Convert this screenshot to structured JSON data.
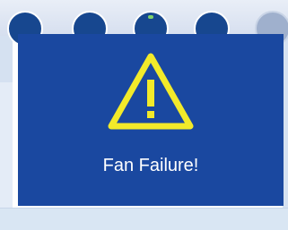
{
  "dialog": {
    "message": "Fan Failure!",
    "icon": "warning-triangle-icon",
    "background_color": "#1a48a0",
    "icon_color": "#f2ea2a"
  },
  "tabs": {
    "circle_icons": [
      "status-circle-icon",
      "status-circle-icon",
      "status-circle-icon",
      "status-circle-icon",
      "status-circle-icon"
    ]
  }
}
